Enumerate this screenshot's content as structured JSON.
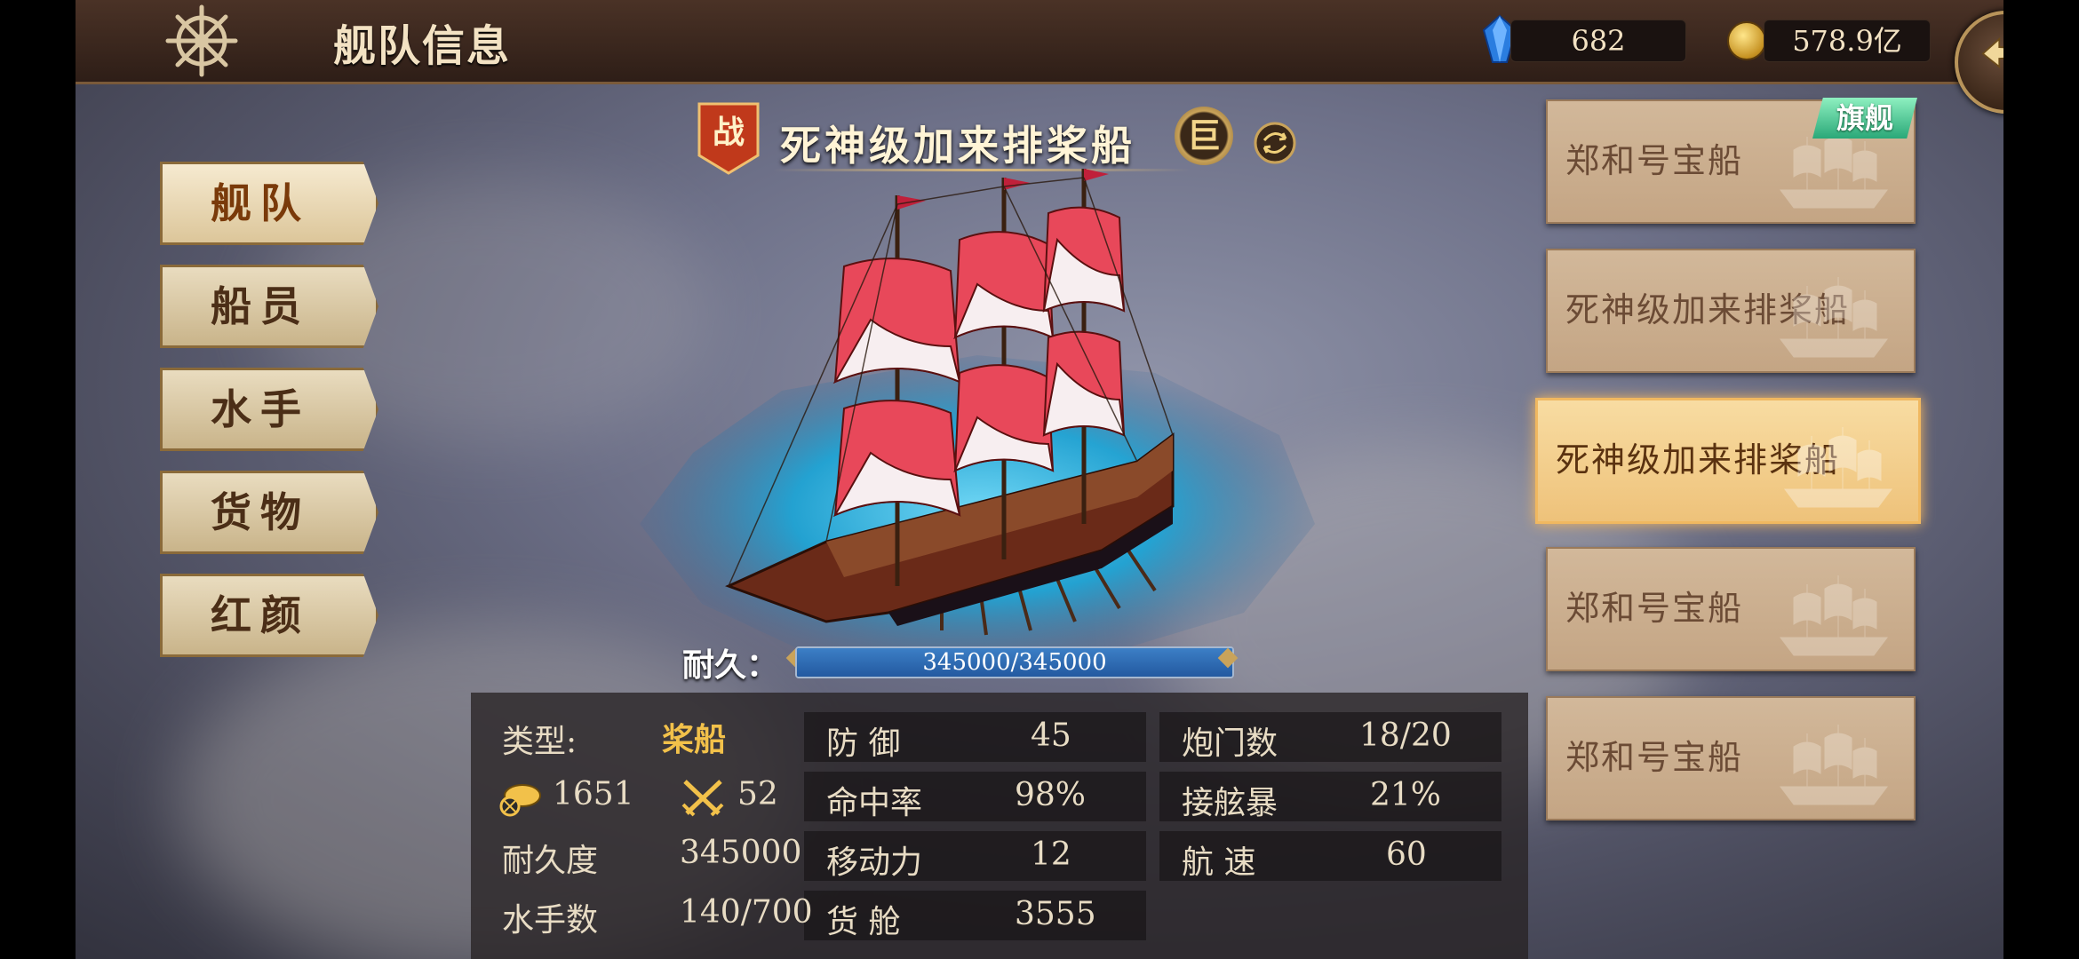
{
  "header": {
    "title": "舰队信息",
    "gems": "682",
    "gold": "578.9亿"
  },
  "menu": [
    "舰队",
    "船员",
    "水手",
    "货物",
    "红颜"
  ],
  "ship": {
    "war_badge": "战",
    "name": "死神级加来排桨船",
    "size_badge": "巨"
  },
  "durability": {
    "label": "耐久：",
    "text": "345000/345000",
    "fraction": 1.0
  },
  "stats": {
    "type_label": "类型:",
    "type_value": "桨船",
    "cannon_value": "1651",
    "melee_value": "52",
    "durability_label": "耐久度",
    "durability_value": "345000",
    "sailors_label": "水手数",
    "sailors_value": "140/700",
    "defense_label": "防 御",
    "defense_value": "45",
    "accuracy_label": "命中率",
    "accuracy_value": "98%",
    "mobility_label": "移动力",
    "mobility_value": "12",
    "cargo_label": "货 舱",
    "cargo_value": "3555",
    "gunports_label": "炮门数",
    "gunports_value": "18/20",
    "boarding_label": "接舷暴",
    "boarding_value": "21%",
    "speed_label": "航 速",
    "speed_value": "60"
  },
  "fleet": [
    {
      "name": "郑和号宝船",
      "selected": false
    },
    {
      "name": "死神级加来排桨船",
      "selected": false
    },
    {
      "name": "死神级加来排桨船",
      "selected": true
    },
    {
      "name": "郑和号宝船",
      "selected": false
    },
    {
      "name": "郑和号宝船",
      "selected": false
    }
  ],
  "flagship_badge": "旗舰",
  "colors": {
    "header_bg": "#3a271e",
    "accent_gold": "#f2c14a",
    "selected_card": "#f5c87a",
    "hp_bar": "#2f6fb8"
  },
  "icons": [
    "ship-wheel-icon",
    "blue-gem-icon",
    "gold-coin-icon",
    "back-arrow-icon",
    "cannon-icon",
    "crossed-swords-icon",
    "switch-icon"
  ]
}
